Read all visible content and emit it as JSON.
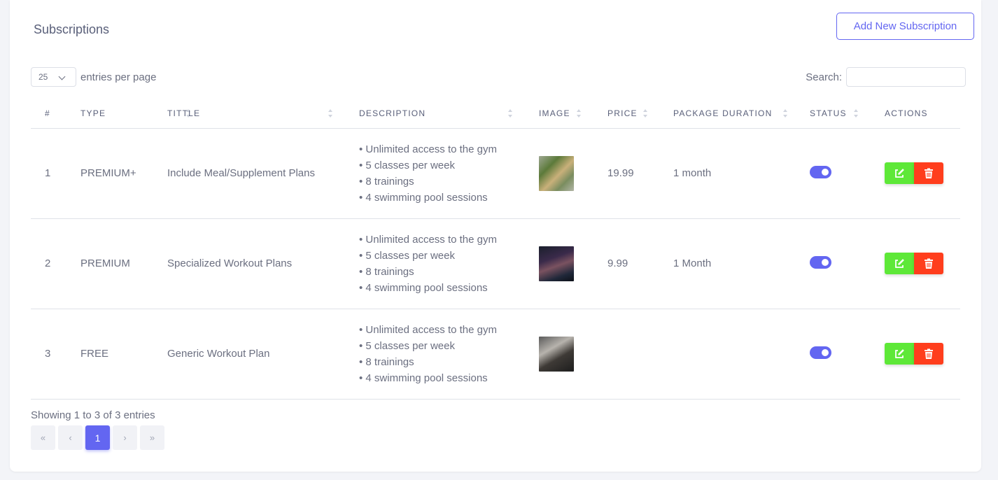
{
  "card": {
    "title": "Subscriptions",
    "add_button": "Add New Subscription"
  },
  "length": {
    "value": "25",
    "label": "entries per page"
  },
  "search": {
    "label": "Search:"
  },
  "columns": [
    "#",
    "TYPE",
    "TITTLE",
    "DESCRIPTION",
    "IMAGE",
    "PRICE",
    "PACKAGE DURATION",
    "STATUS",
    "ACTIONS"
  ],
  "rows": [
    {
      "num": "1",
      "type": "PREMIUM+",
      "title": "Include Meal/Supplement Plans",
      "desc": [
        "• Unlimited access to the gym",
        "• 5 classes per week",
        "• 8 trainings",
        "• 4 swimming pool sessions"
      ],
      "price": "19.99",
      "duration": "1 month",
      "status": "on"
    },
    {
      "num": "2",
      "type": "PREMIUM",
      "title": "Specialized Workout Plans",
      "desc": [
        "• Unlimited access to the gym",
        "• 5 classes per week",
        "• 8 trainings",
        "• 4 swimming pool sessions"
      ],
      "price": "9.99",
      "duration": "1 Month",
      "status": "on"
    },
    {
      "num": "3",
      "type": "FREE",
      "title": "Generic Workout Plan",
      "desc": [
        "• Unlimited access to the gym",
        "• 5 classes per week",
        "• 8 trainings",
        "• 4 swimming pool sessions"
      ],
      "price": "",
      "duration": "",
      "status": "on"
    }
  ],
  "footer": {
    "info": "Showing 1 to 3 of 3 entries"
  },
  "pagination": {
    "first": "«",
    "prev": "‹",
    "current": "1",
    "next": "›",
    "last": "»"
  },
  "colors": {
    "primary": "#6366f1",
    "edit": "#5ee838",
    "delete": "#ff3e1d"
  },
  "icons": {
    "edit": "edit-icon",
    "delete": "trash-icon",
    "dropdown": "chevron-down-icon"
  }
}
